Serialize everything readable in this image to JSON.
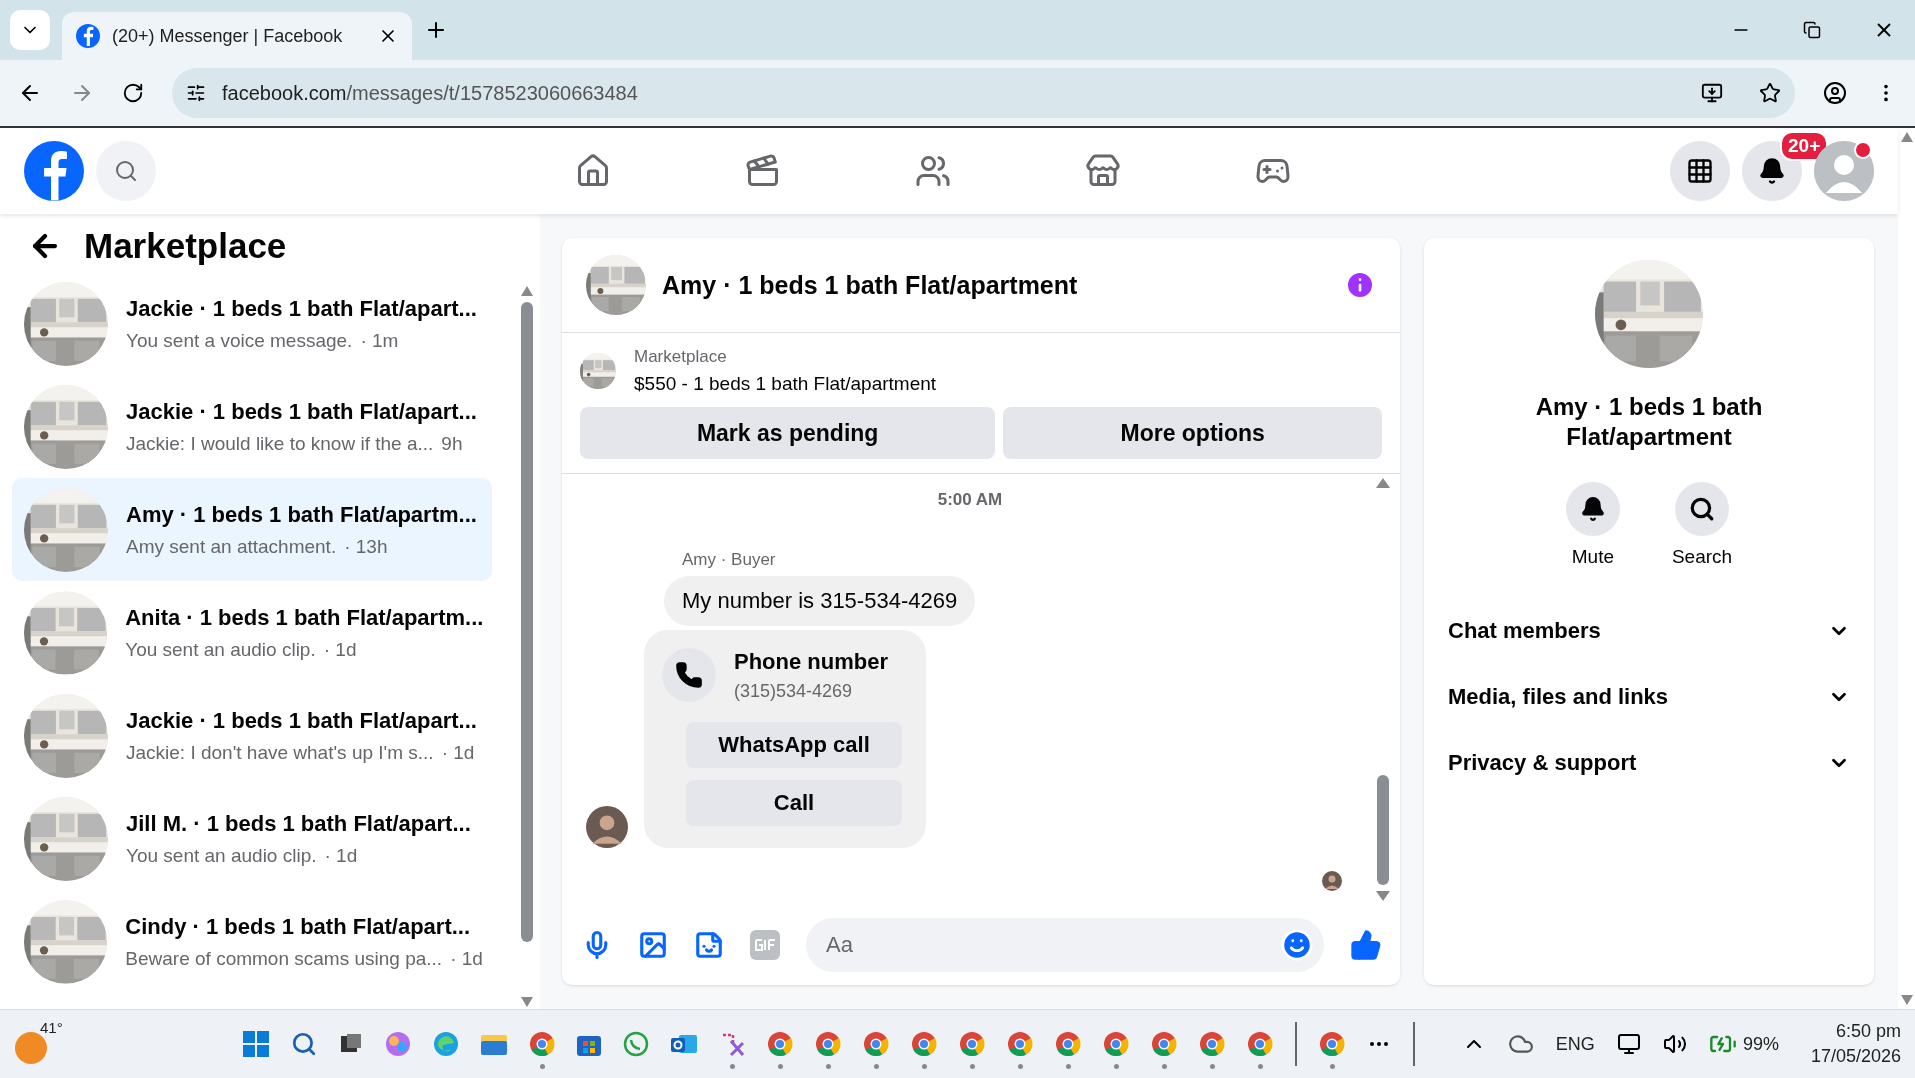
{
  "browser": {
    "tab_title": "(20+) Messenger | Facebook",
    "url_host": "facebook.com",
    "url_path": "/messages/t/1578523060663484"
  },
  "header": {
    "notification_badge": "20+"
  },
  "sidebar": {
    "title": "Marketplace",
    "conversations": [
      {
        "title": "Jackie · 1 beds 1 bath Flat/apart...",
        "preview": "You sent a voice message.",
        "time": "· 1m",
        "selected": false
      },
      {
        "title": "Jackie · 1 beds 1 bath Flat/apart...",
        "preview": "Jackie: I would like to know if the a...",
        "time": "9h",
        "selected": false
      },
      {
        "title": "Amy · 1 beds 1 bath Flat/apartm...",
        "preview": "Amy sent an attachment.",
        "time": "· 13h",
        "selected": true
      },
      {
        "title": "Anita · 1 beds 1 bath Flat/apartm...",
        "preview": "You sent an audio clip.",
        "time": "· 1d",
        "selected": false
      },
      {
        "title": "Jackie · 1 beds 1 bath Flat/apart...",
        "preview": "Jackie: I don't have what's up I'm s...",
        "time": "· 1d",
        "selected": false
      },
      {
        "title": "Jill M. · 1 beds 1 bath Flat/apart...",
        "preview": "You sent an audio clip.",
        "time": "· 1d",
        "selected": false
      },
      {
        "title": "Cindy · 1 beds 1 bath Flat/apart...",
        "preview": "Beware of common scams using pa...",
        "time": "· 1d",
        "selected": false
      }
    ]
  },
  "chat": {
    "title": "Amy · 1 beds 1 bath Flat/apartment",
    "listing": {
      "source": "Marketplace",
      "summary": "$550 - 1 beds 1 bath Flat/apartment",
      "buttons": [
        "Mark as pending",
        "More options"
      ]
    },
    "timestamp": "5:00 AM",
    "sender": "Amy · Buyer",
    "message": "My number is 315-534-4269",
    "phone_card": {
      "title": "Phone number",
      "number": "(315)534-4269",
      "buttons": [
        "WhatsApp call",
        "Call"
      ]
    },
    "composer": {
      "placeholder": "Aa"
    }
  },
  "info_panel": {
    "title": "Amy · 1 beds 1 bath Flat/apartment",
    "actions": [
      "Mute",
      "Search"
    ],
    "sections": [
      {
        "label": "Chat members",
        "expanded": false
      },
      {
        "label": "Media, files and links",
        "expanded": false
      },
      {
        "label": "Privacy & support",
        "expanded": false
      }
    ]
  },
  "taskbar": {
    "weather": "41°",
    "language": "ENG",
    "battery": "99%",
    "time": "6:50 pm",
    "date": "17/05/2026"
  }
}
